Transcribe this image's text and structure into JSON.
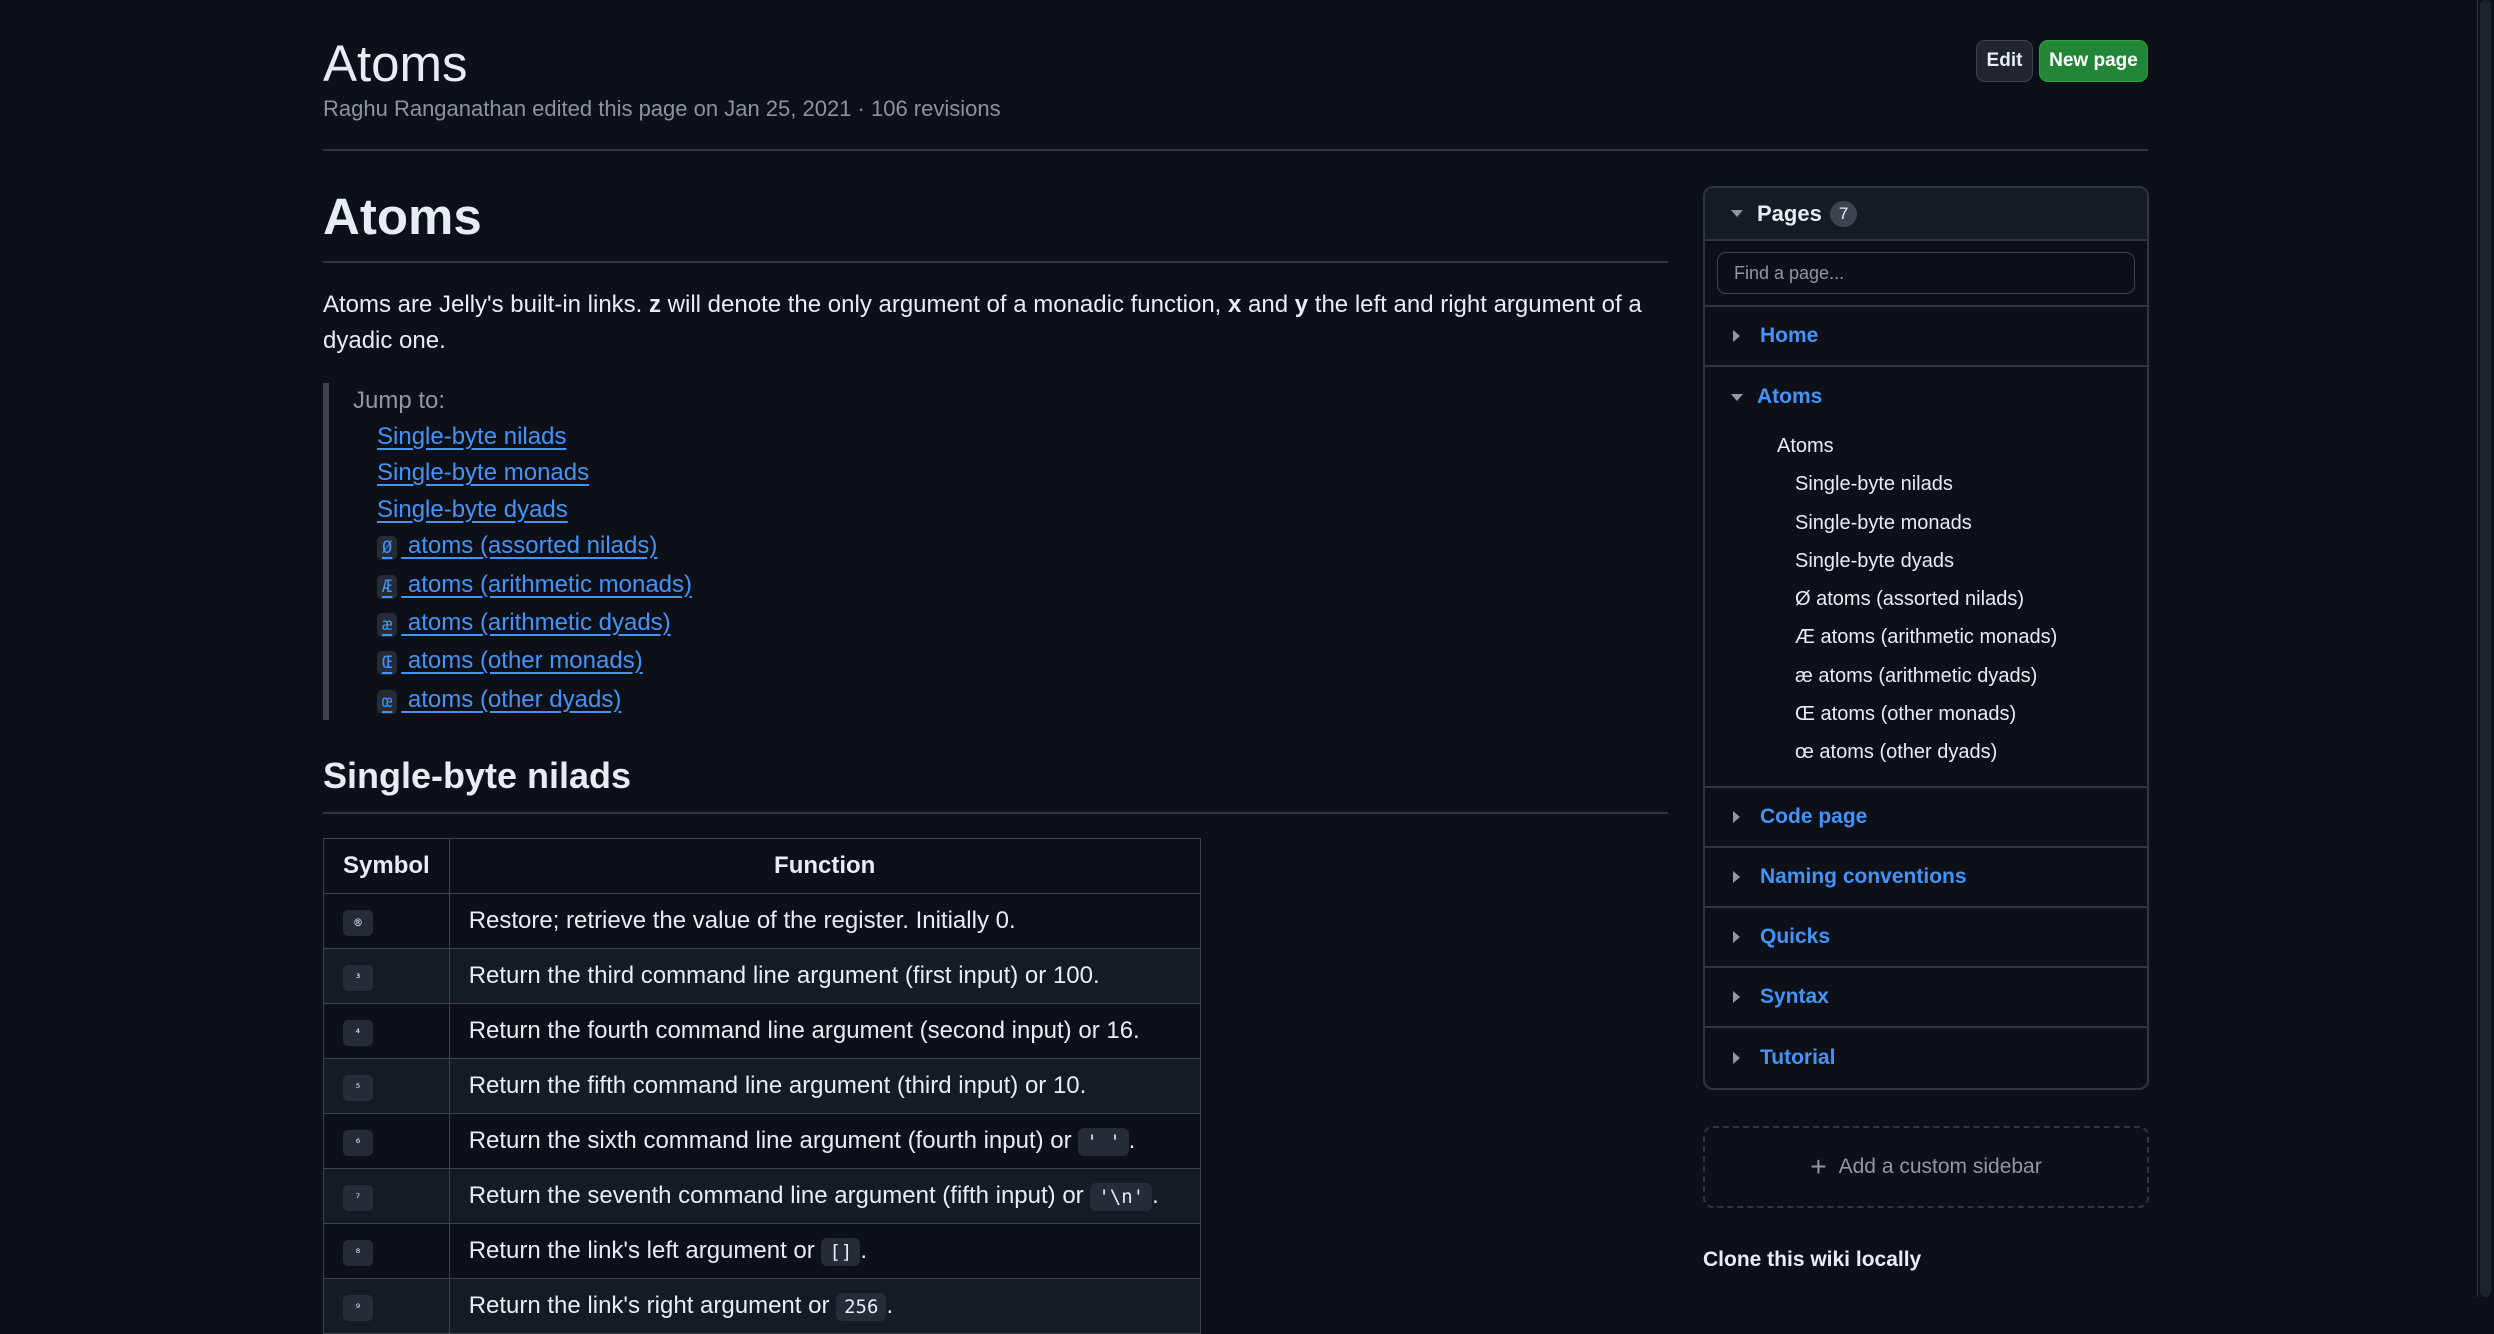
{
  "header": {
    "title": "Atoms",
    "meta": "Raghu Ranganathan edited this page on Jan 25, 2021 · 106 revisions",
    "edit_label": "Edit",
    "new_page_label": "New page"
  },
  "article": {
    "heading": "Atoms",
    "intro_1": "Atoms are Jelly's built-in links. ",
    "intro_z": "z",
    "intro_2": " will denote the only argument of a monadic function, ",
    "intro_x": "x",
    "intro_3": " and ",
    "intro_y": "y",
    "intro_4": " the left and right argument of a dyadic one.",
    "jump_label": "Jump to:",
    "jump_links": [
      {
        "glyph": "",
        "label": "Single-byte nilads"
      },
      {
        "glyph": "",
        "label": "Single-byte monads"
      },
      {
        "glyph": "",
        "label": "Single-byte dyads"
      },
      {
        "glyph": "Ø",
        "label": " atoms (assorted nilads)"
      },
      {
        "glyph": "Æ",
        "label": " atoms (arithmetic monads)"
      },
      {
        "glyph": "æ",
        "label": " atoms (arithmetic dyads)"
      },
      {
        "glyph": "Œ",
        "label": " atoms (other monads)"
      },
      {
        "glyph": "œ",
        "label": " atoms (other dyads)"
      }
    ],
    "section_heading": "Single-byte nilads",
    "table": {
      "headers": [
        "Symbol",
        "Function"
      ],
      "rows": [
        {
          "symbol": "®",
          "text": "Restore; retrieve the value of the register. Initially 0.",
          "code": "",
          "tail": ""
        },
        {
          "symbol": "³",
          "text": "Return the third command line argument (first input) or 100.",
          "code": "",
          "tail": ""
        },
        {
          "symbol": "⁴",
          "text": "Return the fourth command line argument (second input) or 16.",
          "code": "",
          "tail": ""
        },
        {
          "symbol": "⁵",
          "text": "Return the fifth command line argument (third input) or 10.",
          "code": "",
          "tail": ""
        },
        {
          "symbol": "⁶",
          "text": "Return the sixth command line argument (fourth input) or ",
          "code": "' '",
          "tail": "."
        },
        {
          "symbol": "⁷",
          "text": "Return the seventh command line argument (fifth input) or ",
          "code": "'\\n'",
          "tail": "."
        },
        {
          "symbol": "⁸",
          "text": "Return the link's left argument or ",
          "code": "[]",
          "tail": "."
        },
        {
          "symbol": "⁹",
          "text": "Return the link's right argument or ",
          "code": "256",
          "tail": "."
        }
      ]
    }
  },
  "sidebar": {
    "pages_title": "Pages",
    "pages_count": "7",
    "search_placeholder": "Find a page...",
    "pages": [
      {
        "label": "Home"
      },
      {
        "label": "Code page"
      },
      {
        "label": "Naming conventions"
      },
      {
        "label": "Quicks"
      },
      {
        "label": "Syntax"
      },
      {
        "label": "Tutorial"
      }
    ],
    "atoms_label": "Atoms",
    "atoms_toc_top": "Atoms",
    "atoms_toc": [
      "Single-byte nilads",
      "Single-byte monads",
      "Single-byte dyads",
      "Ø atoms (assorted nilads)",
      "Æ atoms (arithmetic monads)",
      "æ atoms (arithmetic dyads)",
      "Œ atoms (other monads)",
      "œ atoms (other dyads)"
    ],
    "custom_sidebar_label": "Add a custom sidebar",
    "clone_title": "Clone this wiki locally"
  },
  "colors": {
    "background": "#0d1117",
    "link": "#4493f8",
    "primary_button": "#238636",
    "border": "#30363d"
  }
}
